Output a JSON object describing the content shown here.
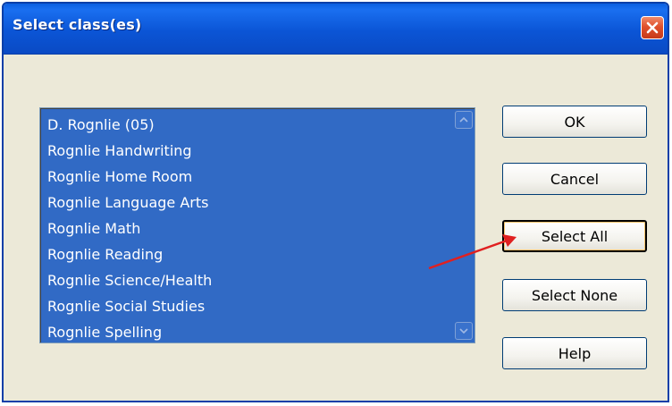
{
  "window": {
    "title": "Select class(es)"
  },
  "listbox": {
    "items": [
      "D. Rognlie (05)",
      "Rognlie Handwriting",
      "Rognlie Home Room",
      "Rognlie Language Arts",
      "Rognlie Math",
      "Rognlie Reading",
      "Rognlie Science/Health",
      "Rognlie Social Studies",
      "Rognlie Spelling"
    ],
    "all_selected": true
  },
  "buttons": {
    "ok": "OK",
    "cancel": "Cancel",
    "select_all": "Select All",
    "select_none": "Select None",
    "help": "Help"
  },
  "colors": {
    "titlebar": "#0b55d6",
    "selection": "#316ac5",
    "close": "#e0502c",
    "dialog_bg": "#ece9d8",
    "annotation_arrow": "#e02020"
  },
  "icons": {
    "close": "close-icon",
    "scroll_up": "chevron-up-icon",
    "scroll_down": "chevron-down-icon",
    "annotation": "annotation-arrow"
  }
}
